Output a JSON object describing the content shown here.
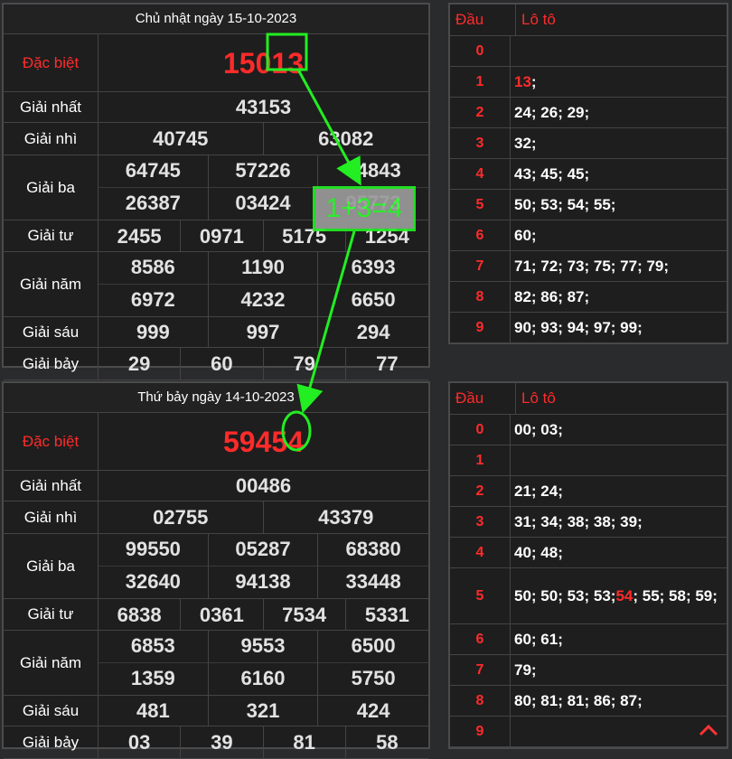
{
  "draws": [
    {
      "title": "Chủ nhật ngày 15-10-2023",
      "labels": {
        "db": "Đặc biệt",
        "g1": "Giải nhất",
        "g2": "Giải nhì",
        "g3": "Giải ba",
        "g4": "Giải tư",
        "g5": "Giải năm",
        "g6": "Giải sáu",
        "g7": "Giải bảy"
      },
      "db": "15013",
      "g1": [
        "43153"
      ],
      "g2": [
        "40745",
        "63082"
      ],
      "g3": [
        "64745",
        "57226",
        "04843",
        "26387",
        "03424",
        "95773"
      ],
      "g4": [
        "2455",
        "0971",
        "5175",
        "1254"
      ],
      "g5": [
        "8586",
        "1190",
        "6393",
        "6972",
        "4232",
        "6650"
      ],
      "g6": [
        "999",
        "997",
        "294"
      ],
      "g7": [
        "29",
        "60",
        "79",
        "77"
      ]
    },
    {
      "title": "Thứ bảy ngày 14-10-2023",
      "labels": {
        "db": "Đặc biệt",
        "g1": "Giải nhất",
        "g2": "Giải nhì",
        "g3": "Giải ba",
        "g4": "Giải tư",
        "g5": "Giải năm",
        "g6": "Giải sáu",
        "g7": "Giải bảy"
      },
      "db": "59454",
      "g1": [
        "00486"
      ],
      "g2": [
        "02755",
        "43379"
      ],
      "g3": [
        "99550",
        "05287",
        "68380",
        "32640",
        "94138",
        "33448"
      ],
      "g4": [
        "6838",
        "0361",
        "7534",
        "5331"
      ],
      "g5": [
        "6853",
        "9553",
        "6500",
        "1359",
        "6160",
        "5750"
      ],
      "g6": [
        "481",
        "321",
        "424"
      ],
      "g7": [
        "03",
        "39",
        "81",
        "58"
      ]
    }
  ],
  "loto": [
    {
      "head_label": "Đầu",
      "loto_label": "Lô tô",
      "rows": [
        {
          "d": "0",
          "v": ""
        },
        {
          "d": "1",
          "v": "13;",
          "hl": "13"
        },
        {
          "d": "2",
          "v": "24; 26; 29;"
        },
        {
          "d": "3",
          "v": "32;"
        },
        {
          "d": "4",
          "v": "43; 45; 45;"
        },
        {
          "d": "5",
          "v": "50; 53; 54; 55;"
        },
        {
          "d": "6",
          "v": "60;"
        },
        {
          "d": "7",
          "v": "71; 72; 73; 75; 77; 79;"
        },
        {
          "d": "8",
          "v": "82; 86; 87;"
        },
        {
          "d": "9",
          "v": "90; 93; 94; 97; 99;"
        }
      ]
    },
    {
      "head_label": "Đầu",
      "loto_label": "Lô tô",
      "rows": [
        {
          "d": "0",
          "v": "00; 03;"
        },
        {
          "d": "1",
          "v": ""
        },
        {
          "d": "2",
          "v": "21; 24;"
        },
        {
          "d": "3",
          "v": "31; 34; 38; 38; 39;"
        },
        {
          "d": "4",
          "v": "40; 48;"
        },
        {
          "d": "5",
          "v": "50; 50; 53; 53; 54; 55; 58; 59;",
          "hl": "54"
        },
        {
          "d": "6",
          "v": "60; 61;"
        },
        {
          "d": "7",
          "v": "79;"
        },
        {
          "d": "8",
          "v": "80; 81; 81; 86; 87;"
        },
        {
          "d": "9",
          "v": ""
        }
      ]
    }
  ],
  "annotation": {
    "formula": "1+3=4"
  },
  "colors": {
    "accent_red": "#ff2b2b",
    "annotation_green": "#22ee22"
  }
}
